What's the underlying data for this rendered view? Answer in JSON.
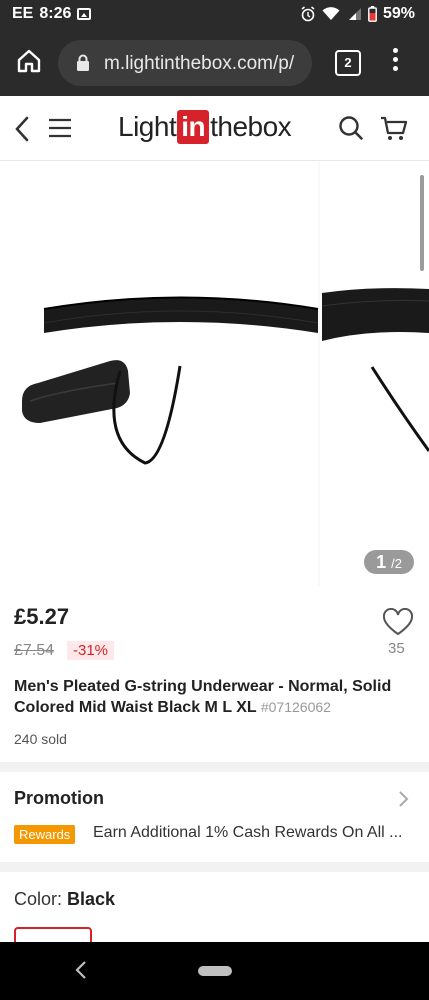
{
  "status_bar": {
    "carrier": "EE",
    "time": "8:26",
    "battery": "59%"
  },
  "browser": {
    "url": "m.lightinthebox.com/p/",
    "tab_count": "2"
  },
  "header": {
    "logo_pre": "Light",
    "logo_in": "in",
    "logo_post": "thebox"
  },
  "gallery": {
    "current": "1",
    "total": "/2"
  },
  "product": {
    "price": "£5.27",
    "old_price": "£7.54",
    "discount": "-31%",
    "likes": "35",
    "title": "Men's Pleated G-string Underwear - Normal, Solid Colored Mid Waist Black M L XL",
    "sku": "#07126062",
    "sold": "240 sold"
  },
  "promotion": {
    "title": "Promotion",
    "badge": "Rewards",
    "text": "Earn Additional 1% Cash Rewards On All ..."
  },
  "color": {
    "label": "Color:",
    "value": "Black"
  },
  "colors": {
    "brand_red": "#d6222a",
    "rewards_orange": "#f39800"
  }
}
